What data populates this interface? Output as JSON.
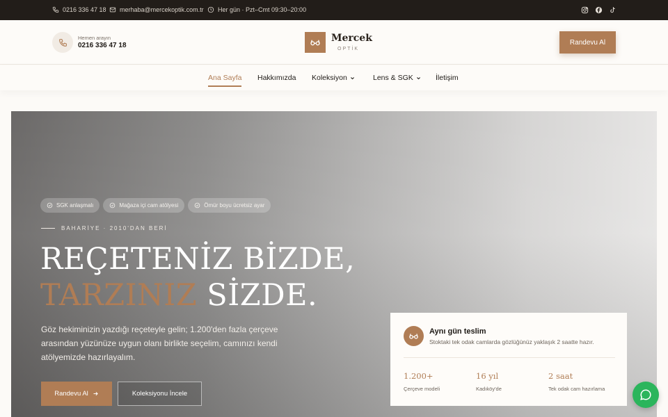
{
  "topbar": {
    "phone": "0216 336 47 18",
    "email": "merhaba@mercekoptik.com.tr",
    "hours": "Her gün · Pzt–Cmt 09:30–20:00",
    "social": [
      "instagram-icon",
      "facebook-icon",
      "tiktok-icon"
    ]
  },
  "header": {
    "call_small": "Hemen arayın",
    "call_number": "0216 336 47 18",
    "logo_name": "Mercek",
    "logo_sub": "OPTİK",
    "cta": "Randevu Al"
  },
  "nav": {
    "items": [
      {
        "label": "Ana Sayfa",
        "active": true
      },
      {
        "label": "Hakkımızda"
      },
      {
        "label": "Koleksiyon",
        "dropdown": true
      },
      {
        "label": "Lens & SGK",
        "dropdown": true
      },
      {
        "label": "İletişim"
      }
    ]
  },
  "hero": {
    "badges": [
      "SGK anlaşmalı",
      "Mağaza içi cam atölyesi",
      "Ömür boyu ücretsiz ayar"
    ],
    "eyebrow": "BAHARİYE · 2010'DAN BERİ",
    "title_line1": "REÇETENİZ BİZDE,",
    "title_accent": "TARZINIZ",
    "title_rest": " SİZDE.",
    "lead": "Göz hekiminizin yazdığı reçeteyle gelin; 1.200'den fazla çerçeve arasından yüzünüze uygun olanı birlikte seçelim, camınızı kendi atölyemizde hazırlayalım.",
    "primary_button": "Randevu Al",
    "secondary_button": "Koleksiyonu İncele"
  },
  "card": {
    "title": "Aynı gün teslim",
    "text": "Stoktaki tek odak camlarda gözlüğünüz yaklaşık 2 saatte hazır.",
    "stats": [
      {
        "value": "1.200+",
        "label": "Çerçeve modeli"
      },
      {
        "value": "16 yıl",
        "label": "Kadıköy'de"
      },
      {
        "value": "2 saat",
        "label": "Tek odak cam hazırlama"
      }
    ]
  },
  "colors": {
    "accent": "#b07d55",
    "topbar": "#221d19",
    "chat": "#2bb55c"
  }
}
